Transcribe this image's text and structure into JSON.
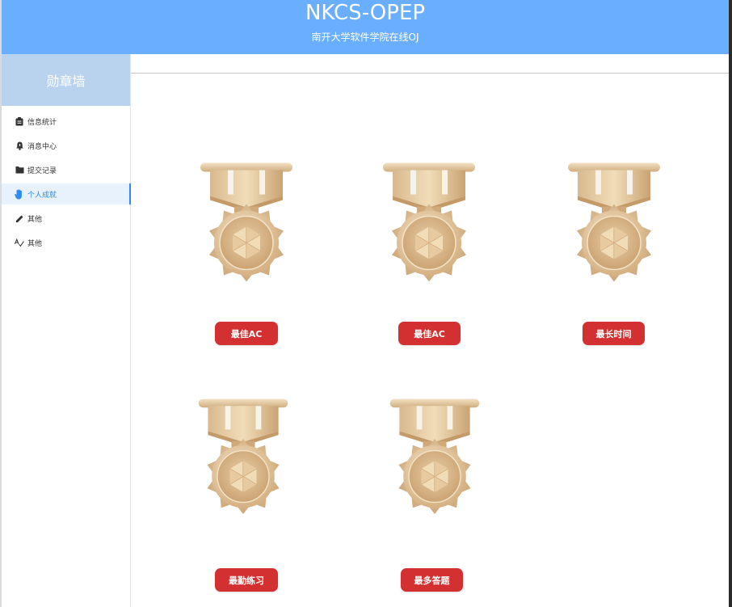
{
  "header": {
    "title": "NKCS-OPEP",
    "subtitle": "南开大学软件学院在线OJ"
  },
  "sidebar": {
    "title": "勋章墙",
    "items": [
      {
        "label": "信息统计",
        "icon": "clipboard-icon"
      },
      {
        "label": "消息中心",
        "icon": "bell-icon"
      },
      {
        "label": "提交记录",
        "icon": "folder-icon"
      },
      {
        "label": "个人成就",
        "icon": "hand-icon",
        "active": true
      },
      {
        "label": "其他",
        "icon": "pencil-icon"
      },
      {
        "label": "其他",
        "icon": "spellcheck-icon"
      }
    ]
  },
  "medals": [
    {
      "label": "最佳AC"
    },
    {
      "label": "最佳AC"
    },
    {
      "label": "最长时间"
    },
    {
      "label": "最勤练习"
    },
    {
      "label": "最多答题"
    }
  ],
  "colors": {
    "header": "#6aaeff",
    "sidebar_title": "#b9d3ef",
    "accent": "#2d8cf0",
    "badge": "#d33131",
    "medal_gold": "#e4c59a"
  }
}
